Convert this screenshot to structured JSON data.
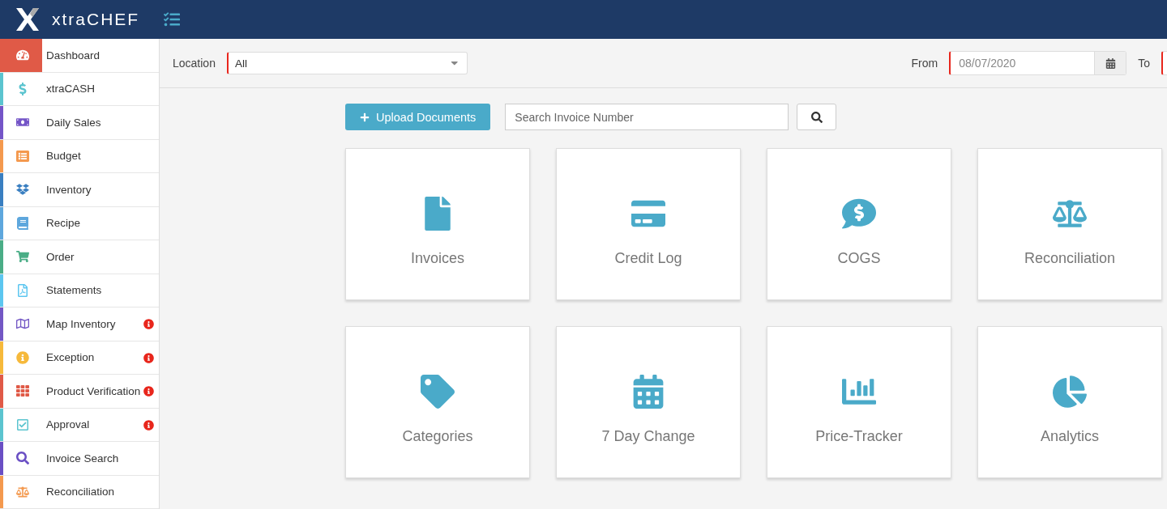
{
  "header": {
    "brand": "xtraCHEF"
  },
  "sidebar": {
    "items": [
      {
        "label": "Dashboard",
        "selected": true,
        "alert": false,
        "color": "#e05a47"
      },
      {
        "label": "xtraCASH",
        "selected": false,
        "alert": false,
        "color": "#5bc4cf"
      },
      {
        "label": "Daily Sales",
        "selected": false,
        "alert": false,
        "color": "#7455c7"
      },
      {
        "label": "Budget",
        "selected": false,
        "alert": false,
        "color": "#f4994e"
      },
      {
        "label": "Inventory",
        "selected": false,
        "alert": false,
        "color": "#3a7fc1"
      },
      {
        "label": "Recipe",
        "selected": false,
        "alert": false,
        "color": "#5ea7dd"
      },
      {
        "label": "Order",
        "selected": false,
        "alert": false,
        "color": "#4aad86"
      },
      {
        "label": "Statements",
        "selected": false,
        "alert": false,
        "color": "#5cc6f0"
      },
      {
        "label": "Map Inventory",
        "selected": false,
        "alert": true,
        "color": "#7357c4"
      },
      {
        "label": "Exception",
        "selected": false,
        "alert": true,
        "color": "#f6b93b"
      },
      {
        "label": "Product Verification",
        "selected": false,
        "alert": true,
        "color": "#e05a47"
      },
      {
        "label": "Approval",
        "selected": false,
        "alert": true,
        "color": "#5bc4cf"
      },
      {
        "label": "Invoice Search",
        "selected": false,
        "alert": false,
        "color": "#6a4fc4"
      },
      {
        "label": "Reconciliation",
        "selected": false,
        "alert": false,
        "color": "#f4994e"
      }
    ]
  },
  "filters": {
    "location_label": "Location",
    "location_value": "All",
    "from_label": "From",
    "from_value": "08/07/2020",
    "to_label": "To"
  },
  "toolbar": {
    "upload_button": "Upload Documents",
    "search": {
      "placeholder": "Search Invoice Number"
    }
  },
  "tiles": [
    {
      "label": "Invoices"
    },
    {
      "label": "Credit Log"
    },
    {
      "label": "COGS"
    },
    {
      "label": "Reconciliation"
    },
    {
      "label": "Categories"
    },
    {
      "label": "7 Day Change"
    },
    {
      "label": "Price-Tracker"
    },
    {
      "label": "Analytics"
    }
  ]
}
